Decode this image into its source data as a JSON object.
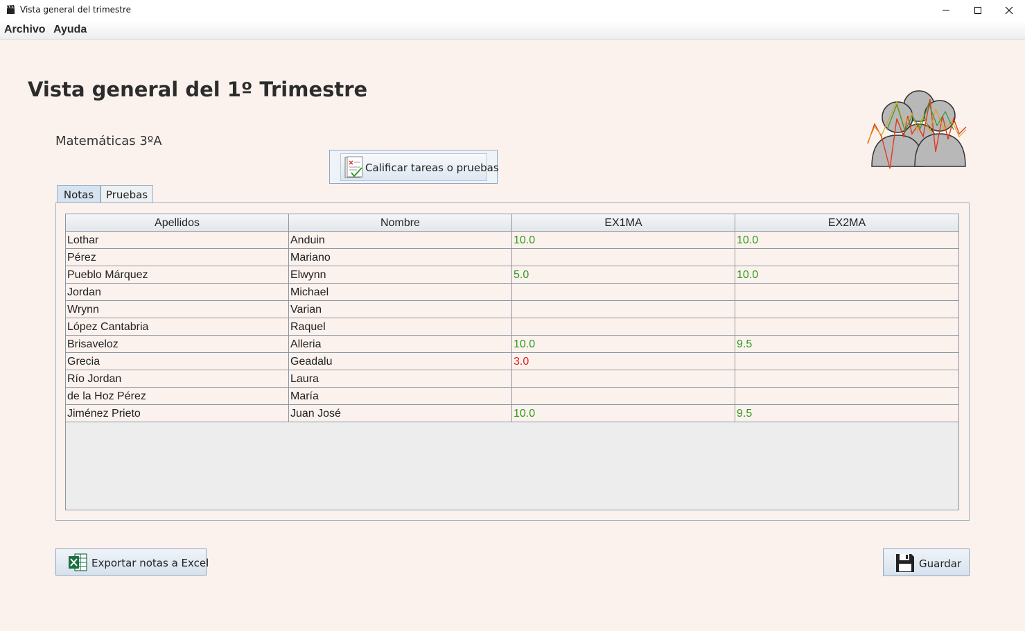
{
  "window": {
    "title": "Vista general del trimestre",
    "icon": "clapperboard-icon",
    "controls": [
      "minimize-icon",
      "maximize-icon",
      "close-icon"
    ]
  },
  "menu": {
    "items": [
      "Archivo",
      "Ayuda"
    ]
  },
  "header": {
    "title": "Vista general del 1º Trimestre",
    "subject": "Matemáticas 3ºA",
    "logo": "students-chart-icon"
  },
  "actions": {
    "grade_label": "Calificar tareas o pruebas",
    "grade_icon": "checklist-icon",
    "export_label": "Exportar notas a Excel",
    "export_icon": "excel-icon",
    "save_label": "Guardar",
    "save_icon": "floppy-disk-icon"
  },
  "tabs": [
    {
      "label": "Notas",
      "selected": true
    },
    {
      "label": "Pruebas",
      "selected": false
    }
  ],
  "table": {
    "columns": [
      "Apellidos",
      "Nombre",
      "EX1MA",
      "EX2MA"
    ],
    "rows": [
      {
        "apellidos": "Lothar",
        "nombre": "Anduin",
        "ex1": "10.0",
        "ex2": "10.0"
      },
      {
        "apellidos": "Pérez",
        "nombre": "Mariano",
        "ex1": "",
        "ex2": ""
      },
      {
        "apellidos": "Pueblo Márquez",
        "nombre": "Elwynn",
        "ex1": "5.0",
        "ex2": "10.0"
      },
      {
        "apellidos": "Jordan",
        "nombre": "Michael",
        "ex1": "",
        "ex2": ""
      },
      {
        "apellidos": "Wrynn",
        "nombre": "Varian",
        "ex1": "",
        "ex2": ""
      },
      {
        "apellidos": "López Cantabria",
        "nombre": "Raquel",
        "ex1": "",
        "ex2": ""
      },
      {
        "apellidos": "Brisaveloz",
        "nombre": "Alleria",
        "ex1": "10.0",
        "ex2": "9.5"
      },
      {
        "apellidos": "Grecia",
        "nombre": "Geadalu",
        "ex1": "3.0",
        "ex2": ""
      },
      {
        "apellidos": "Río Jordan",
        "nombre": "Laura",
        "ex1": "",
        "ex2": ""
      },
      {
        "apellidos": "de la Hoz Pérez",
        "nombre": "María",
        "ex1": "",
        "ex2": ""
      },
      {
        "apellidos": "Jiménez Prieto",
        "nombre": "Juan José",
        "ex1": "10.0",
        "ex2": "9.5"
      }
    ]
  },
  "colors": {
    "pass": "#2f9a1b",
    "fail": "#e21a1a",
    "background": "#fbf2ee"
  }
}
